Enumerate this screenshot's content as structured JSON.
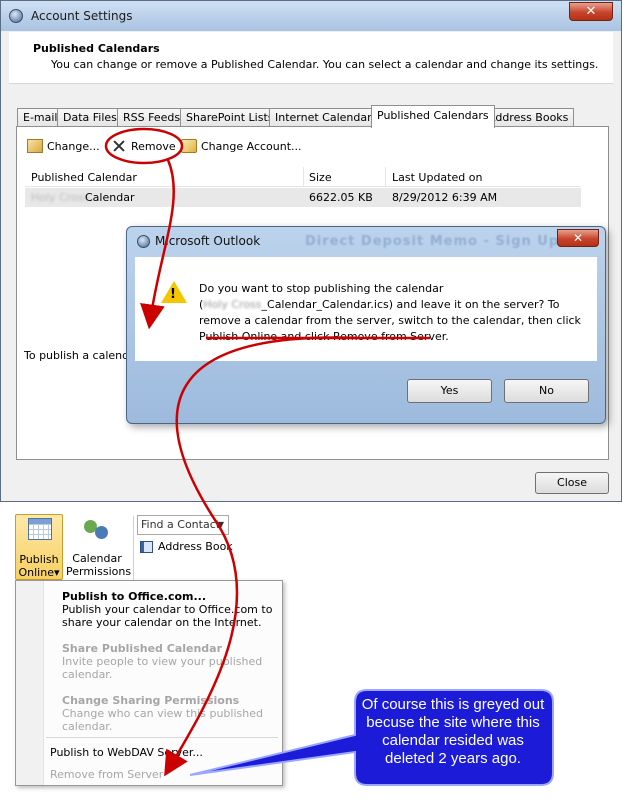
{
  "window": {
    "title": "Account Settings",
    "close_glyph": "✕",
    "header_title": "Published Calendars",
    "header_subtitle": "You can change or remove a Published Calendar. You can select a calendar and change its settings."
  },
  "tabs": [
    {
      "label": "E-mail"
    },
    {
      "label": "Data Files"
    },
    {
      "label": "RSS Feeds"
    },
    {
      "label": "SharePoint Lists"
    },
    {
      "label": "Internet Calendars"
    },
    {
      "label": "Published Calendars",
      "active": true
    },
    {
      "label": "Address Books"
    }
  ],
  "toolbar": {
    "change_label": "Change...",
    "remove_label": "Remove",
    "change_account_label": "Change Account..."
  },
  "list": {
    "headers": [
      "Published Calendar",
      "Size",
      "Last Updated on"
    ],
    "rows": [
      {
        "name_blurred": "Holy Cross",
        "name": "Calendar",
        "size": "6622.05 KB",
        "updated": "8/29/2012 6:39 AM"
      }
    ]
  },
  "panel_note": "To publish a calendar",
  "close_button": "Close",
  "dialog": {
    "title": "Microsoft Outlook",
    "ghost_title": "Direct Deposit Memo - Sign Up",
    "close_glyph": "✕",
    "message_line1": "Do you want to stop publishing the calendar",
    "message_open_paren": "(",
    "message_blurred": "Holy Cross",
    "message_line2_rest": "_Calendar_Calendar.ics) and leave it on the server? To remove a calendar from the server, switch to the calendar, then click Publish Online and click Remove from Server.",
    "yes_label": "Yes",
    "no_label": "No"
  },
  "ribbon": {
    "publish_label_1": "Publish",
    "publish_label_2": "Online",
    "publish_arrow": "▾",
    "permissions_label_1": "Calendar",
    "permissions_label_2": "Permissions",
    "find_contact_placeholder": "Find a Contact",
    "find_contact_arrow": "▼",
    "address_book_label": "Address Book"
  },
  "publish_menu": {
    "items": [
      {
        "title": "Publish to Office.com...",
        "desc_1": "Publish your calendar to Office.com to",
        "desc_2": "share your calendar on the Internet.",
        "enabled": true
      },
      {
        "title": "Share Published Calendar",
        "desc_1": "Invite people to view your published",
        "desc_2": "calendar.",
        "enabled": false
      },
      {
        "title": "Change Sharing Permissions",
        "desc_1": "Change who can view this published",
        "desc_2": "calendar.",
        "enabled": false
      },
      {
        "title": "Publish to WebDAV Server...",
        "enabled": true
      },
      {
        "title": "Remove from Server",
        "enabled": false
      }
    ]
  },
  "callout": {
    "text": "Of course this is greyed out becuse the site where this calendar resided was deleted 2 years ago.",
    "fill_color": "#1b1bd8",
    "annotation_color": "#cc0000"
  }
}
